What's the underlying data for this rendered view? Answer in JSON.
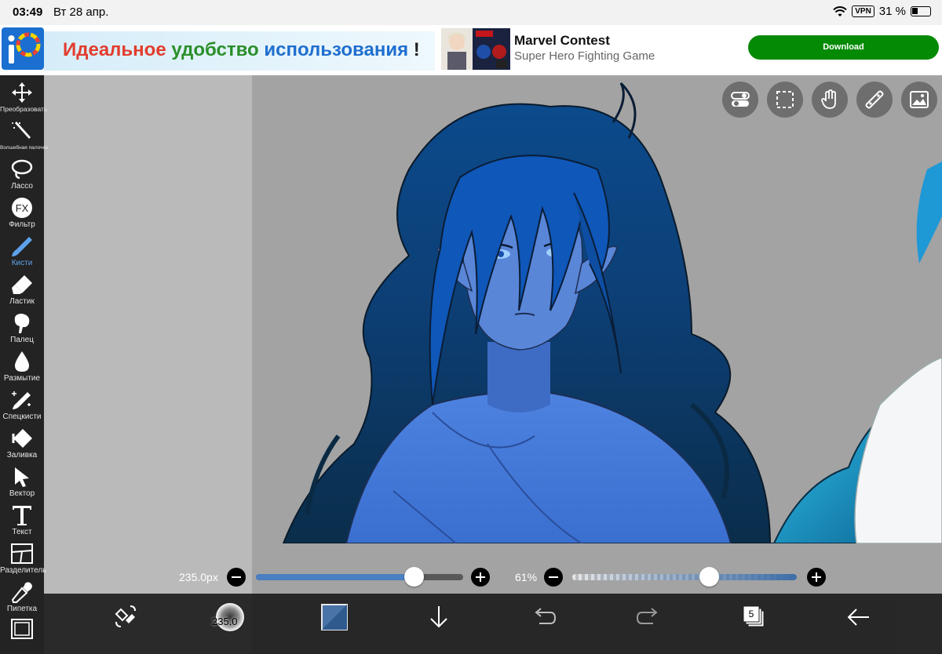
{
  "status_bar": {
    "time": "03:49",
    "date": "Вт 28 апр.",
    "vpn": "VPN",
    "battery": "31 %",
    "battery_level": 0.31
  },
  "ad": {
    "slogan_parts": [
      "Идеальное",
      "удобство",
      "использования",
      "!"
    ],
    "slogan_colors": [
      "#e23c2d",
      "#2a8f2a",
      "#1f6fcf",
      "#222222"
    ],
    "title": "Marvel Contest",
    "subtitle": "Super Hero Fighting Game",
    "download_label": "Download",
    "download_color": "#058a05"
  },
  "canvas_buttons": [
    "toggle-icon",
    "selection-icon",
    "hand-icon",
    "ruler-icon",
    "image-icon"
  ],
  "tools": [
    {
      "label": "Преобразовать",
      "icon": "move-icon"
    },
    {
      "label": "Волшебная палочка",
      "icon": "magic-wand-icon"
    },
    {
      "label": "Лассо",
      "icon": "lasso-icon"
    },
    {
      "label": "Фильтр",
      "icon": "fx-icon"
    },
    {
      "label": "Кисти",
      "icon": "brush-icon",
      "active": true
    },
    {
      "label": "Ластик",
      "icon": "eraser-icon"
    },
    {
      "label": "Палец",
      "icon": "smudge-icon"
    },
    {
      "label": "Размытие",
      "icon": "blur-icon"
    },
    {
      "label": "Спецкисти",
      "icon": "special-brush-icon"
    },
    {
      "label": "Заливка",
      "icon": "fill-icon"
    },
    {
      "label": "Вектор",
      "icon": "vector-icon"
    },
    {
      "label": "Текст",
      "icon": "text-icon"
    },
    {
      "label": "Разделитель",
      "icon": "frame-divider-icon"
    },
    {
      "label": "Пипетка",
      "icon": "eyedropper-icon"
    },
    {
      "label": "",
      "icon": "canvas-icon"
    }
  ],
  "brush_size": {
    "label": "235.0px",
    "value": 235.0,
    "fraction": 0.76
  },
  "opacity": {
    "label": "61%",
    "value": 61,
    "fraction": 0.61
  },
  "bottom_bar": {
    "brush_size_label": "235.0",
    "layers_count": "5"
  },
  "colors": {
    "accent": "#5ea2ec",
    "slider_blue": "#4a7fc1",
    "toolbar_bg": "#232323"
  }
}
